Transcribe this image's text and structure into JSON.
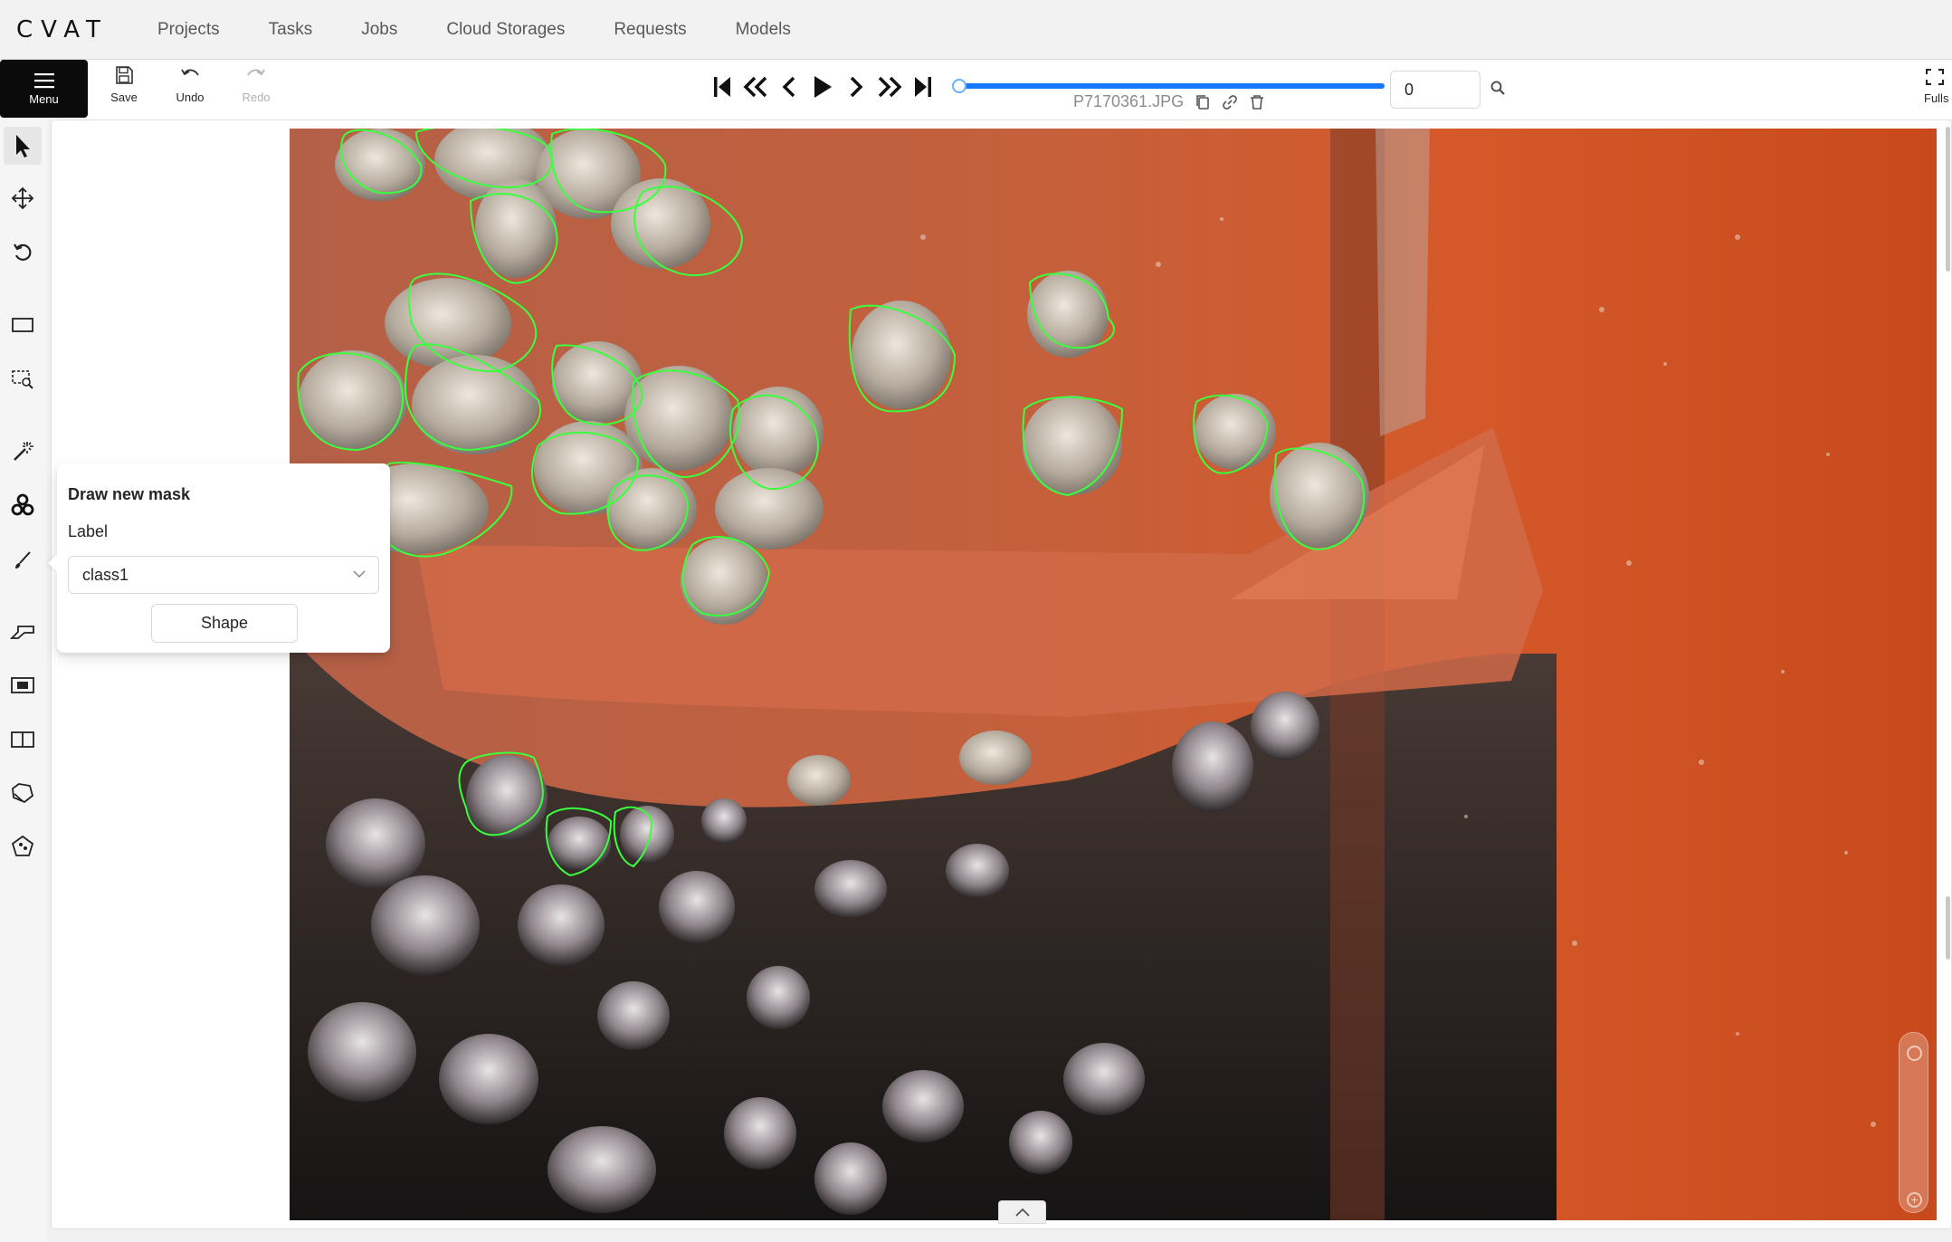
{
  "app": {
    "logo": "CVAT"
  },
  "nav": {
    "items": [
      {
        "label": "Projects"
      },
      {
        "label": "Tasks"
      },
      {
        "label": "Jobs"
      },
      {
        "label": "Cloud Storages"
      },
      {
        "label": "Requests"
      },
      {
        "label": "Models"
      }
    ]
  },
  "toolbar": {
    "menu_label": "Menu",
    "save_label": "Save",
    "undo_label": "Undo",
    "redo_label": "Redo",
    "fullscreen_label": "Fulls"
  },
  "player": {
    "filename": "P7170361.JPG",
    "frame_number": "0",
    "progress": 0
  },
  "popover": {
    "title": "Draw new mask",
    "label_caption": "Label",
    "selected_label": "class1",
    "shape_button": "Shape"
  },
  "colors": {
    "accent": "#1677ff",
    "annotation_outline": "#39ff3c",
    "menu_bg": "#0b0b0b"
  }
}
